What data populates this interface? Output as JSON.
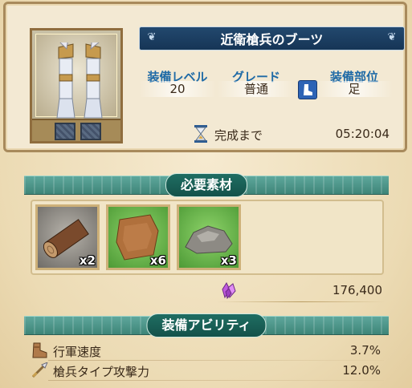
{
  "item": {
    "name": "近衛槍兵のブーツ",
    "icon": "boots-icon"
  },
  "stats": {
    "level_label": "装備レベル",
    "level_value": "20",
    "grade_label": "グレード",
    "grade_value": "普通",
    "slot_label": "装備部位",
    "slot_value": "足",
    "slot_icon": "boot-slot-icon"
  },
  "timer": {
    "label": "完成まで",
    "value": "05:20:04",
    "icon": "hourglass-icon"
  },
  "materials": {
    "title": "必要素材",
    "items": [
      {
        "icon": "log-icon",
        "count": "x2"
      },
      {
        "icon": "leather-icon",
        "count": "x6"
      },
      {
        "icon": "stone-icon",
        "count": "x3"
      }
    ],
    "crystal_icon": "crystal-icon",
    "crystal_value": "176,400"
  },
  "abilities": {
    "title": "装備アビリティ",
    "items": [
      {
        "icon": "boot-icon",
        "label": "行軍速度",
        "value": "3.7%"
      },
      {
        "icon": "spear-icon",
        "label": "槍兵タイプ攻撃力",
        "value": "12.0%"
      }
    ]
  },
  "colors": {
    "banner": "#1b3f63",
    "section": "#3e8578",
    "stat_label": "#1e6aa6"
  }
}
